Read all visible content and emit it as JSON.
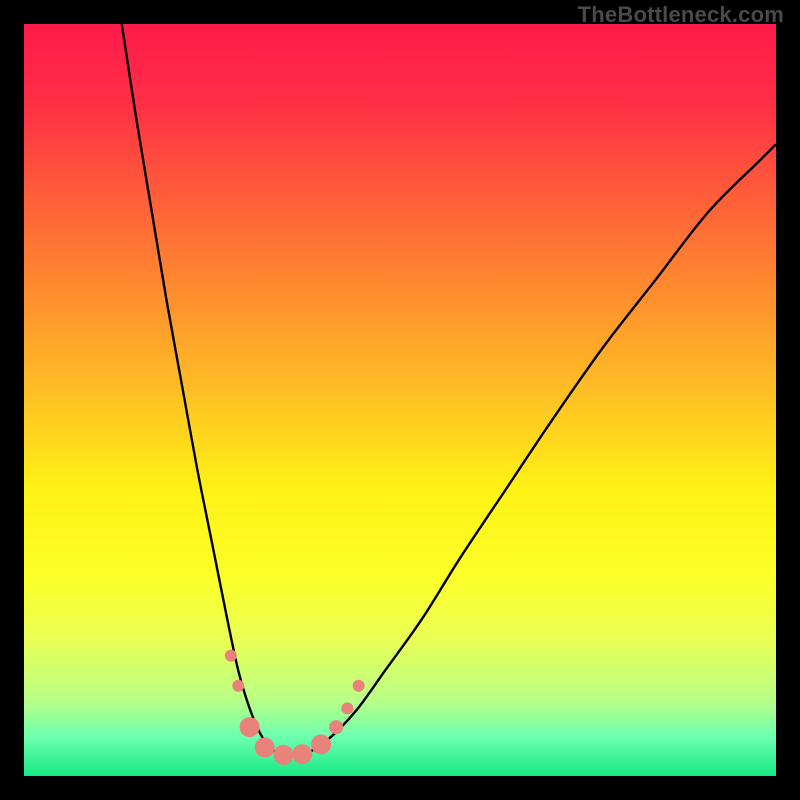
{
  "watermark": "TheBottleneck.com",
  "gradient": {
    "stops": [
      {
        "offset": 0.0,
        "color": "#ff1b4b"
      },
      {
        "offset": 0.1,
        "color": "#ff2d46"
      },
      {
        "offset": 0.22,
        "color": "#ff5a3a"
      },
      {
        "offset": 0.35,
        "color": "#ff8a2f"
      },
      {
        "offset": 0.5,
        "color": "#ffc323"
      },
      {
        "offset": 0.62,
        "color": "#fff215"
      },
      {
        "offset": 0.74,
        "color": "#fbff2a"
      },
      {
        "offset": 0.82,
        "color": "#e8ff55"
      },
      {
        "offset": 0.9,
        "color": "#b8ff88"
      },
      {
        "offset": 0.95,
        "color": "#6affb0"
      },
      {
        "offset": 1.0,
        "color": "#17e884"
      }
    ]
  },
  "chart_data": {
    "type": "line",
    "title": "",
    "xlabel": "",
    "ylabel": "",
    "xlim": [
      0,
      100
    ],
    "ylim": [
      0,
      100
    ],
    "series": [
      {
        "name": "bottleneck-curve",
        "x": [
          13,
          15,
          17,
          19,
          21,
          23,
          25,
          27,
          28.5,
          30,
          31.5,
          33,
          35,
          37,
          40,
          44,
          48,
          53,
          58,
          64,
          70,
          77,
          84,
          91,
          98,
          100
        ],
        "y": [
          100,
          87,
          75,
          63,
          52,
          41,
          31,
          21,
          14,
          9,
          5.5,
          3.5,
          2.7,
          2.8,
          4.5,
          8.5,
          14,
          21,
          29,
          38,
          47,
          57,
          66,
          75,
          82,
          84
        ]
      }
    ],
    "markers": [
      {
        "x": 27.5,
        "y": 16,
        "r": 6
      },
      {
        "x": 28.5,
        "y": 12,
        "r": 6
      },
      {
        "x": 30.0,
        "y": 6.5,
        "r": 10
      },
      {
        "x": 32.0,
        "y": 3.8,
        "r": 10
      },
      {
        "x": 34.5,
        "y": 2.8,
        "r": 10
      },
      {
        "x": 37.0,
        "y": 2.9,
        "r": 10
      },
      {
        "x": 39.5,
        "y": 4.2,
        "r": 10
      },
      {
        "x": 41.5,
        "y": 6.5,
        "r": 7
      },
      {
        "x": 43.0,
        "y": 9.0,
        "r": 6
      },
      {
        "x": 44.5,
        "y": 12,
        "r": 6
      }
    ],
    "marker_color": "#e8827a"
  }
}
